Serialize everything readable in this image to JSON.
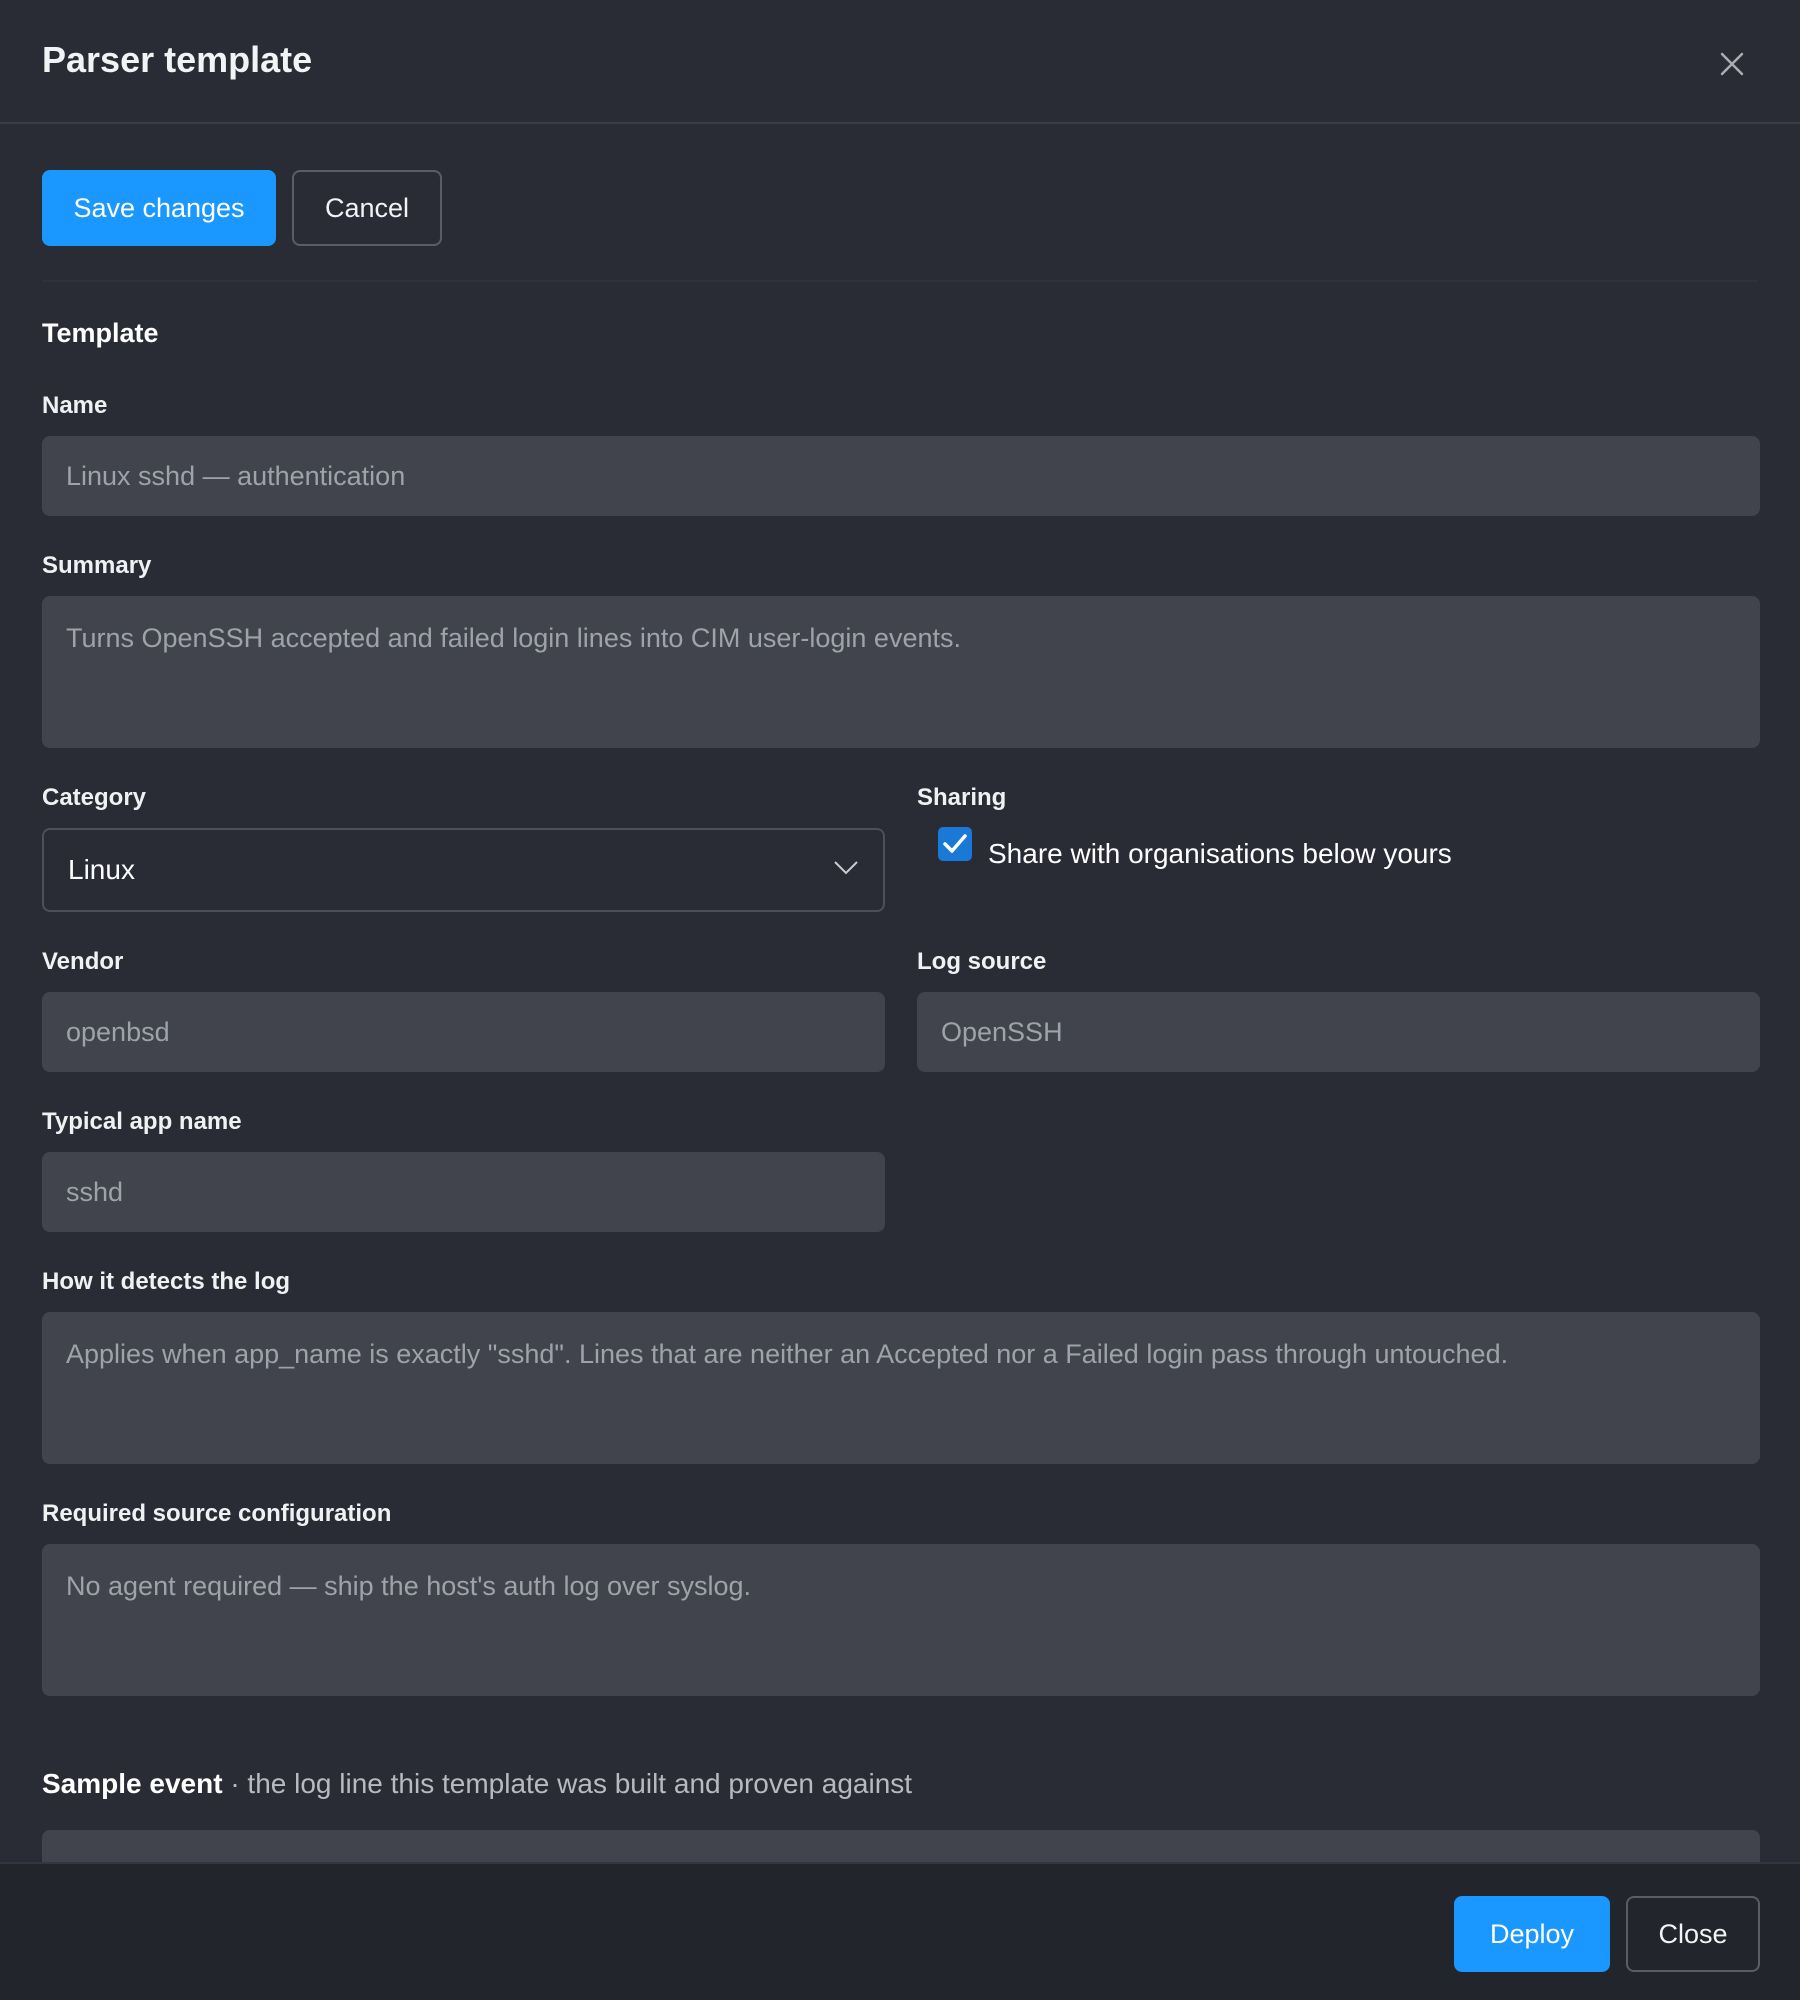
{
  "dialog": {
    "title": "Parser template",
    "close_icon": "close-icon"
  },
  "toolbar": {
    "save_label": "Save changes",
    "cancel_label": "Cancel"
  },
  "template": {
    "section_title": "Template",
    "name": {
      "label": "Name",
      "placeholder": "Linux sshd — authentication"
    },
    "summary": {
      "label": "Summary",
      "placeholder": "Turns OpenSSH accepted and failed login lines into CIM user-login events."
    },
    "category": {
      "label": "Category",
      "value": "Linux"
    },
    "sharing": {
      "label": "Sharing",
      "checkbox_label": "Share with organisations below yours",
      "checked": true
    },
    "vendor": {
      "label": "Vendor",
      "placeholder": "openbsd"
    },
    "log_source": {
      "label": "Log source",
      "placeholder": "OpenSSH"
    },
    "typical_app_name": {
      "label": "Typical app name",
      "placeholder": "sshd"
    },
    "detection": {
      "label": "How it detects the log",
      "placeholder": "Applies when app_name is exactly \"sshd\". Lines that are neither an Accepted nor a Failed login pass through untouched."
    },
    "source_config": {
      "label": "Required source configuration",
      "placeholder": "No agent required — ship the host's auth log over syslog."
    }
  },
  "sample_event": {
    "title": "Sample event",
    "subtitle": "· the log line this template was built and proven against"
  },
  "footer": {
    "deploy_label": "Deploy",
    "close_label": "Close"
  },
  "colors": {
    "accent": "#1a98ff",
    "background": "#292c34",
    "field": "#41444c",
    "checkbox": "#1a78d6"
  }
}
